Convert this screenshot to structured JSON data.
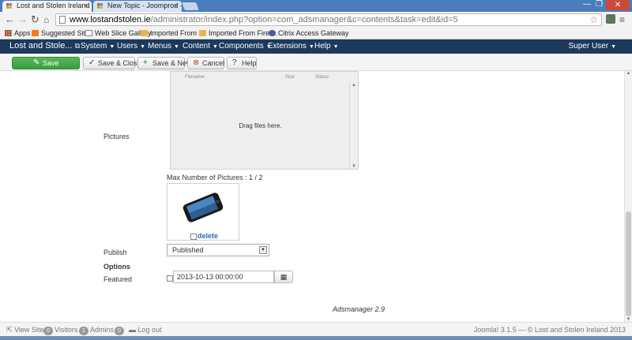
{
  "browser": {
    "tabs": [
      {
        "title": "Lost and Stolen Ireland - J",
        "active": true
      },
      {
        "title": "New Topic - Joomprod -",
        "active": false
      }
    ],
    "url_host": "www.lostandstolen.ie",
    "url_path": "/administrator/index.php?option=com_adsmanager&c=contents&task=edit&id=5",
    "bookmarks": [
      "Apps",
      "Suggested Sites",
      "Web Slice Gallery",
      "Imported From IE",
      "Imported From Firef...",
      "Citrix Access Gateway"
    ]
  },
  "navbar": {
    "brand": "Lost and Stole...",
    "brand_icon": "external-link-icon",
    "menu": [
      "System",
      "Users",
      "Menus",
      "Content",
      "Components",
      "Extensions",
      "Help"
    ],
    "user": "Super User"
  },
  "toolbar": {
    "save": "Save",
    "save_close": "Save & Close",
    "save_new": "Save & New",
    "cancel": "Cancel",
    "help": "Help"
  },
  "form": {
    "uploader": {
      "col_filename": "Filename",
      "col_size": "Size",
      "col_status": "Status",
      "drop_text": "Drag files here."
    },
    "pictures_label": "Pictures",
    "max_pictures": "Max Number of Pictures : 1 / 2",
    "delete_label": "delete",
    "publish_label": "Publish",
    "publish_value": "Published",
    "options_label": "Options",
    "featured_label": "Featured",
    "featured_date": "2013-10-13 00:00:00",
    "version": "Adsmanager 2.9"
  },
  "status": {
    "view_site": "View Site",
    "visitors_count": "0",
    "visitors_label": "Visitors",
    "admins_count": "1",
    "admins_label": "Admins",
    "messages_count": "0",
    "logout": "Log out",
    "footer_right": "Joomla! 3.1.5 — © Lost and Stolen Ireland 2013"
  },
  "colors": {
    "navbar": "#1b3a5c",
    "save_green": "#46a849",
    "link_blue": "#2a69b8"
  }
}
